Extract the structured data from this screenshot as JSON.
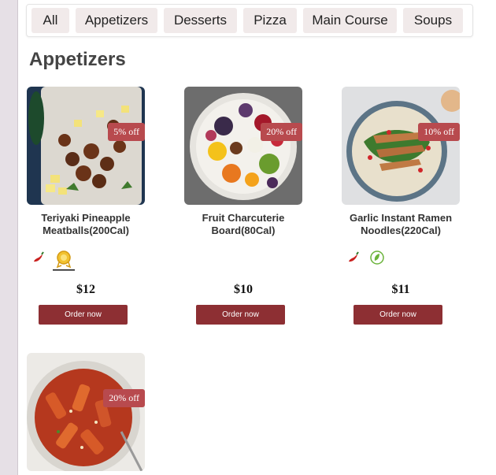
{
  "tabs": [
    {
      "label": "All"
    },
    {
      "label": "Appetizers"
    },
    {
      "label": "Desserts"
    },
    {
      "label": "Pizza"
    },
    {
      "label": "Main Course"
    },
    {
      "label": "Soups"
    }
  ],
  "section_title": "Appetizers",
  "items": [
    {
      "name": "Teriyaki Pineapple Meatballs(200Cal)",
      "discount": "5% off",
      "price": "$12",
      "order_label": "Order now",
      "icons": [
        "chili-icon",
        "award-badge-icon"
      ]
    },
    {
      "name": "Fruit Charcuterie Board(80Cal)",
      "discount": "20% off",
      "price": "$10",
      "order_label": "Order now",
      "icons": []
    },
    {
      "name": "Garlic Instant Ramen Noodles(220Cal)",
      "discount": "10% off",
      "price": "$11",
      "order_label": "Order now",
      "icons": [
        "chili-icon",
        "vegan-leaf-icon"
      ]
    },
    {
      "name": "",
      "discount": "20% off",
      "price": "",
      "order_label": "",
      "icons": []
    }
  ],
  "colors": {
    "accent": "#8d2f33",
    "badge": "#b84a4e",
    "tab_bg": "#f1eaea"
  }
}
